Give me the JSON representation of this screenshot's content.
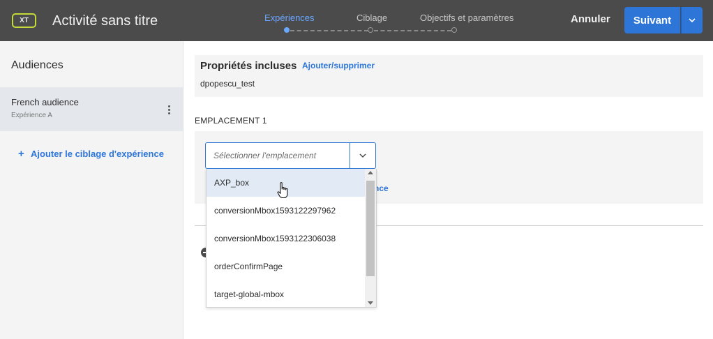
{
  "header": {
    "badge": "XT",
    "title": "Activité sans titre",
    "steps": [
      "Expériences",
      "Ciblage",
      "Objectifs et paramètres"
    ],
    "active_step": 0,
    "cancel_label": "Annuler",
    "next_label": "Suivant"
  },
  "sidebar": {
    "title": "Audiences",
    "audience": {
      "name": "French audience",
      "sub": "Expérience A"
    },
    "add_label": "Ajouter le ciblage d'expérience",
    "add_glyph": "+"
  },
  "main": {
    "props_title": "Propriétés incluses",
    "props_link": "Ajouter/supprimer",
    "props_value": "dpopescu_test",
    "location_label": "EMPLACEMENT 1",
    "hidden_link_fragment": "nce",
    "select_placeholder": "Sélectionner l'emplacement",
    "options": [
      "AXP_box",
      "conversionMbox1593122297962",
      "conversionMbox1593122306038",
      "orderConfirmPage",
      "target-global-mbox"
    ],
    "hovered_option": 0
  },
  "colors": {
    "header_bg": "#4b4b4b",
    "accent": "#2d75d7",
    "active_step": "#6aa7ff",
    "badge_border": "#c6d93a"
  }
}
